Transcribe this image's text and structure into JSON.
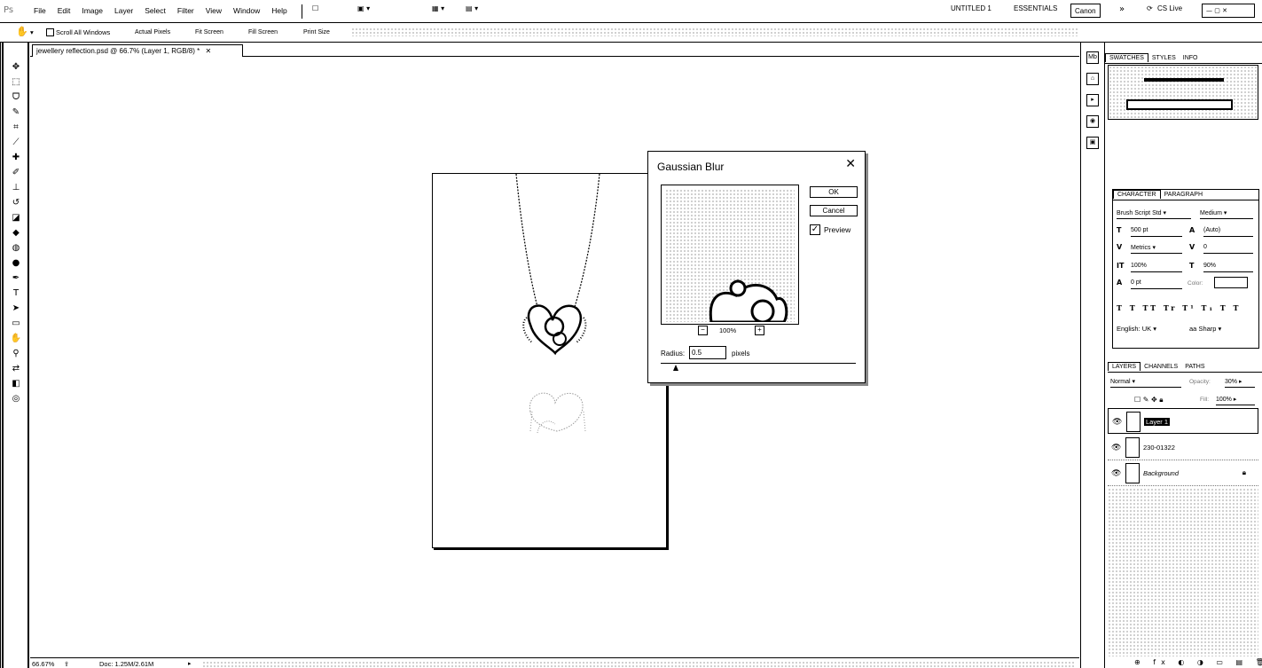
{
  "menubar": {
    "logo": "Ps",
    "menus": [
      "File",
      "Edit",
      "Image",
      "Layer",
      "Select",
      "Filter",
      "View",
      "Window",
      "Help"
    ],
    "workspace_untitled": "UNTITLED 1",
    "workspace_essentials": "ESSENTIALS",
    "workspace_current": "Canon",
    "cs_live": "CS Live"
  },
  "options": {
    "scroll_all_windows": "Scroll All Windows",
    "actual_pixels": "Actual Pixels",
    "fit_screen": "Fit Screen",
    "fill_screen": "Fill Screen",
    "print_size": "Print Size"
  },
  "document": {
    "tab_title": "jewellery reflection.psd @ 66.7% (Layer 1, RGB/8) *"
  },
  "gaussian_blur": {
    "title": "Gaussian Blur",
    "ok": "OK",
    "cancel": "Cancel",
    "preview_label": "Preview",
    "preview_checked": true,
    "zoom": "100%",
    "radius_label": "Radius:",
    "radius_value": "0.5",
    "radius_unit": "pixels"
  },
  "panels": {
    "top_tabs": [
      "SWATCHES",
      "STYLES",
      "INFO"
    ],
    "char_tabs": [
      "CHARACTER",
      "PARAGRAPH"
    ],
    "layers_tabs": [
      "LAYERS",
      "CHANNELS",
      "PATHS"
    ]
  },
  "character": {
    "font_family": "Brush Script Std",
    "font_style": "Medium",
    "font_size": "500 pt",
    "leading": "(Auto)",
    "kerning": "Metrics",
    "tracking": "0",
    "vertical_scale": "100%",
    "horizontal_scale": "90%",
    "baseline_shift": "0 pt",
    "color_label": "Color:",
    "language": "English: UK",
    "antialias_icon": "aa",
    "antialias": "Sharp"
  },
  "layers": {
    "blend_mode": "Normal",
    "opacity_label": "Opacity:",
    "opacity": "30%",
    "fill_label": "Fill:",
    "fill": "100%",
    "items": [
      {
        "name": "Layer 1",
        "selected": true
      },
      {
        "name": "230-01322",
        "selected": false
      },
      {
        "name": "Background",
        "selected": false,
        "locked": true
      }
    ]
  },
  "status": {
    "zoom": "66.67%",
    "doc": "Doc: 1.25M/2.61M"
  }
}
